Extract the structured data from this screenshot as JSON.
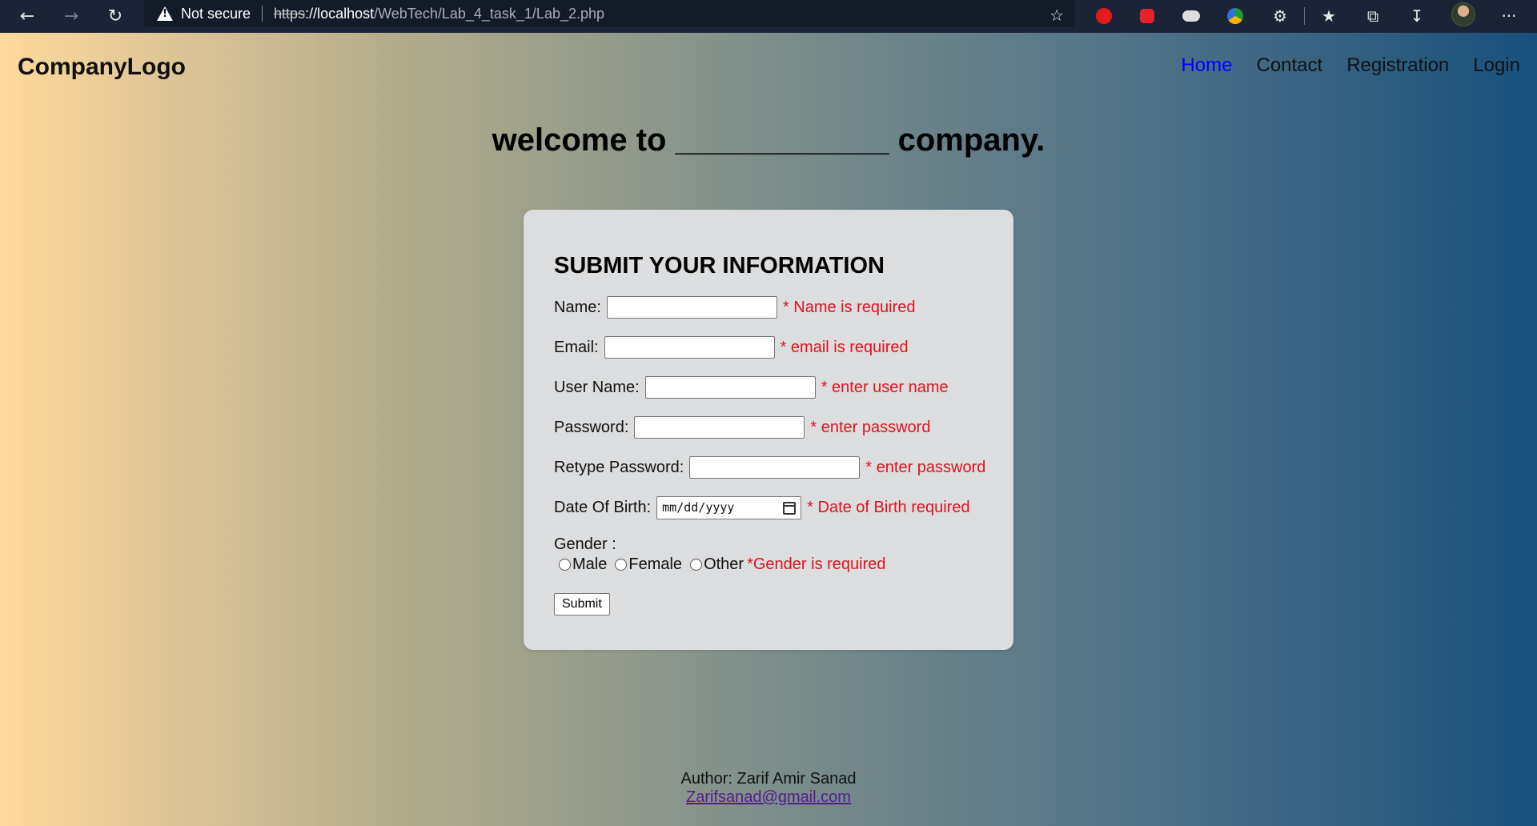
{
  "browser": {
    "not_secure": "Not secure",
    "url_scheme": "https",
    "url_host": "://localhost",
    "url_path": "/WebTech/Lab_4_task_1/Lab_2.php",
    "more_label": "···"
  },
  "header": {
    "logo": "CompanyLogo",
    "nav": [
      {
        "label": "Home",
        "active": true
      },
      {
        "label": "Contact",
        "active": false
      },
      {
        "label": "Registration",
        "active": false
      },
      {
        "label": "Login",
        "active": false
      }
    ]
  },
  "welcome": "welcome to ____________ company.",
  "form": {
    "title": "SUBMIT YOUR INFORMATION",
    "fields": {
      "name": {
        "label": "Name:",
        "value": "",
        "error": "* Name is required"
      },
      "email": {
        "label": "Email:",
        "value": "",
        "error": "* email is required"
      },
      "username": {
        "label": "User Name:",
        "value": "",
        "error": "* enter user name"
      },
      "password": {
        "label": "Password:",
        "value": "",
        "error": "* enter password"
      },
      "retype": {
        "label": "Retype Password:",
        "value": "",
        "error": "* enter password"
      },
      "dob": {
        "label": "Date Of Birth:",
        "placeholder": "mm/dd/yyyy",
        "error": "* Date of Birth required"
      }
    },
    "gender": {
      "label": "Gender :",
      "options": [
        "Male",
        "Female",
        "Other"
      ],
      "error": "*Gender is required"
    },
    "submit_label": "Submit"
  },
  "footer": {
    "author": "Author: Zarif Amir Sanad",
    "email": "Zarifsanad@gmail.com"
  },
  "colors": {
    "error": "#e0121a",
    "active_nav": "#0000ff",
    "gradient_left": "#fdd99c",
    "gradient_right": "#18507d",
    "card": "#dcdddf"
  }
}
